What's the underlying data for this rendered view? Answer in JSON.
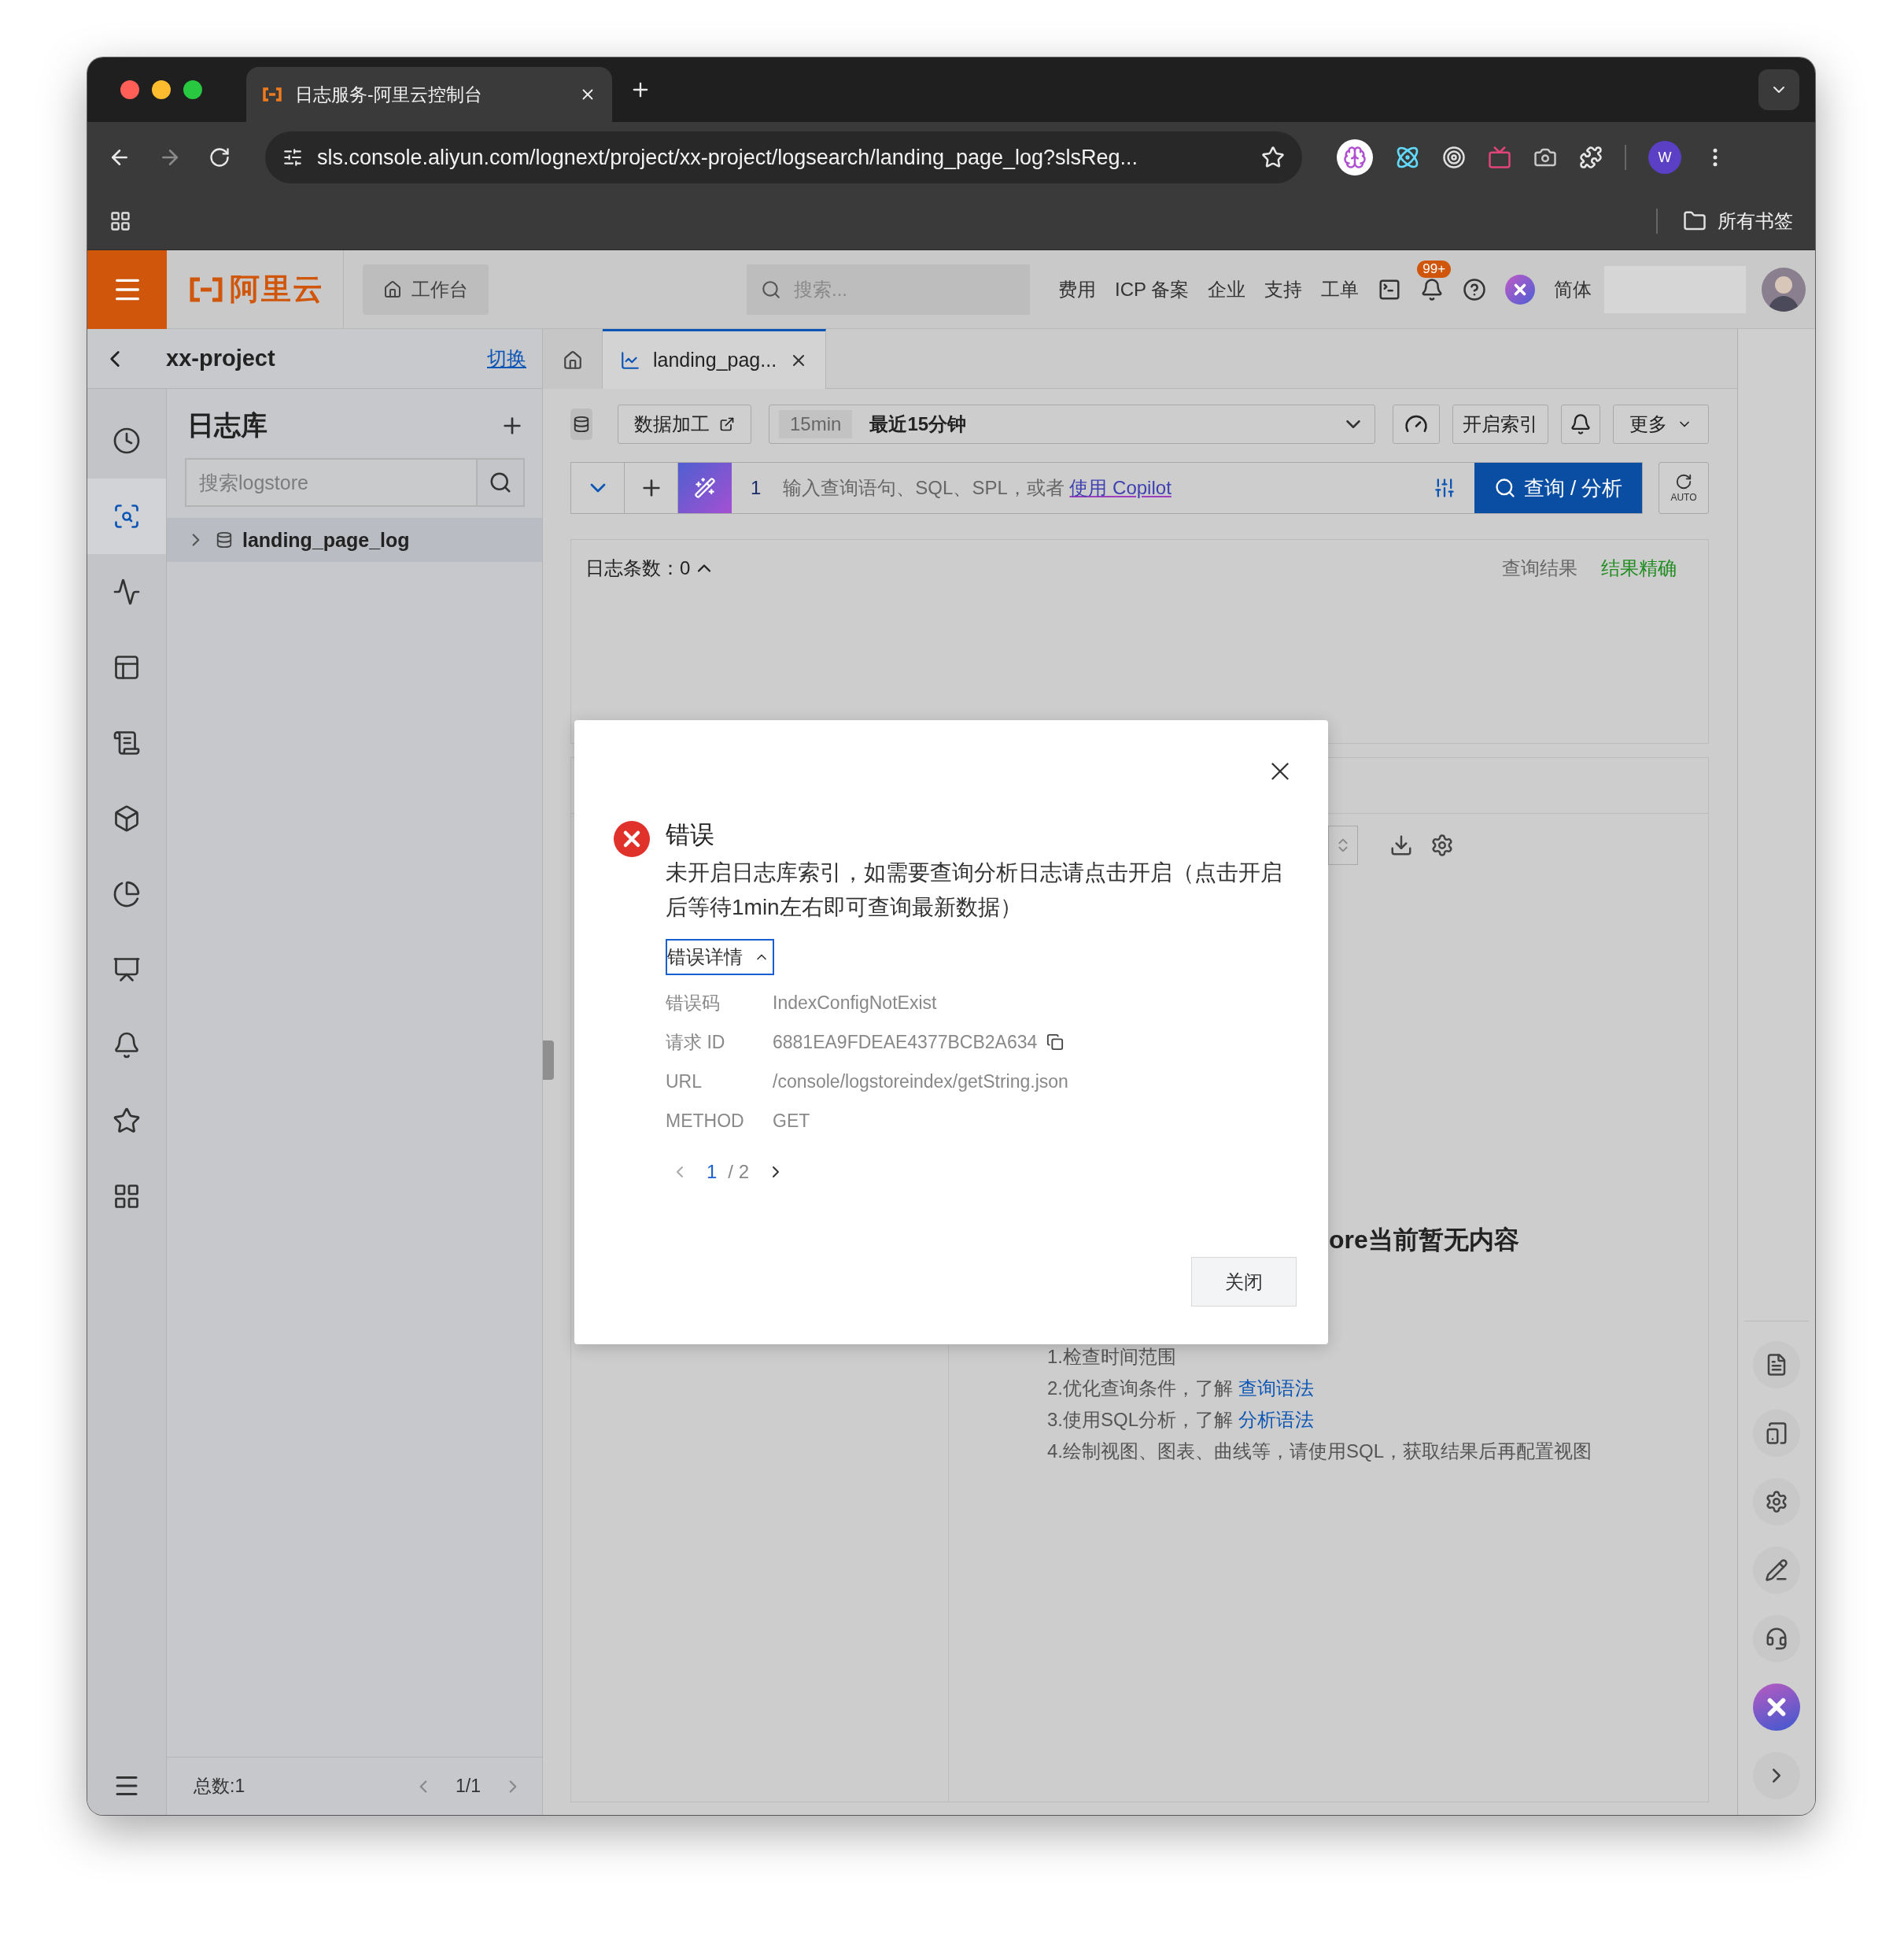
{
  "browser": {
    "tab_title": "日志服务-阿里云控制台",
    "url": "sls.console.aliyun.com/lognext/project/xx-project/logsearch/landing_page_log?slsReg...",
    "profile": "W",
    "bookmarks": "所有书签"
  },
  "header": {
    "brand": "阿里云",
    "workbench": "工作台",
    "search": {
      "placeholder": "搜索..."
    },
    "links": [
      "费用",
      "ICP 备案",
      "企业",
      "支持",
      "工单"
    ],
    "notifications": "99+",
    "language": "简体"
  },
  "project": {
    "name": "xx-project",
    "switch": "切换"
  },
  "tabs": [
    {
      "kind": "home",
      "selected": false
    },
    {
      "kind": "page",
      "label": "landing_pag...",
      "selected": true
    }
  ],
  "nav_rail": [
    {
      "selected": false
    },
    {
      "selected": true
    },
    {
      "selected": false
    },
    {
      "selected": false
    },
    {
      "selected": false
    },
    {
      "selected": false
    },
    {
      "selected": false
    },
    {
      "selected": false
    },
    {
      "selected": false
    },
    {
      "selected": false
    },
    {
      "selected": false
    }
  ],
  "logstores": {
    "title": "日志库",
    "search": {
      "placeholder": "搜索logstore"
    },
    "items": [
      {
        "name": "landing_page_log",
        "expanded": false
      }
    ],
    "total": "总数:1",
    "pager": "1/1"
  },
  "toolbar": {
    "data_process": "数据加工",
    "time_badge": "15min",
    "time_range": "最近15分钟",
    "enable_index": "开启索引",
    "more": "更多"
  },
  "query": {
    "line": "1",
    "placeholder": "输入查询语句、SQL、SPL，或者 ",
    "copilot": "使用 Copilot",
    "submit": "查询 / 分析",
    "auto": "AUTO"
  },
  "results": {
    "count_label": "日志条数：",
    "count": "0",
    "expanded": true,
    "status_label": "查询结果",
    "status": "结果精确"
  },
  "empty": {
    "title": "ore当前暂无内容",
    "hints": [
      {
        "text": "1.检查时间范围"
      },
      {
        "text": "2.优化查询条件，了解 ",
        "link": "查询语法"
      },
      {
        "text": "3.使用SQL分析，了解 ",
        "link": "分析语法"
      },
      {
        "text": "4.绘制视图、图表、曲线等，请使用SQL，获取结果后再配置视图"
      }
    ]
  },
  "dialog": {
    "title": "错误",
    "message": "未开启日志库索引，如需要查询分析日志请点击开启（点击开启后等待1min左右即可查询最新数据）",
    "details_toggle": "错误详情",
    "details_expanded": true,
    "details": [
      {
        "label": "错误码",
        "value": "IndexConfigNotExist",
        "copyable": false
      },
      {
        "label": "请求 ID",
        "value": "6881EA9FDEAE4377BCB2A634",
        "copyable": true
      },
      {
        "label": "URL",
        "value": "/console/logstoreindex/getString.json",
        "copyable": false
      },
      {
        "label": "METHOD",
        "value": "GET",
        "copyable": false
      }
    ],
    "page": "1",
    "pages": "/ 2",
    "close": "关闭"
  }
}
